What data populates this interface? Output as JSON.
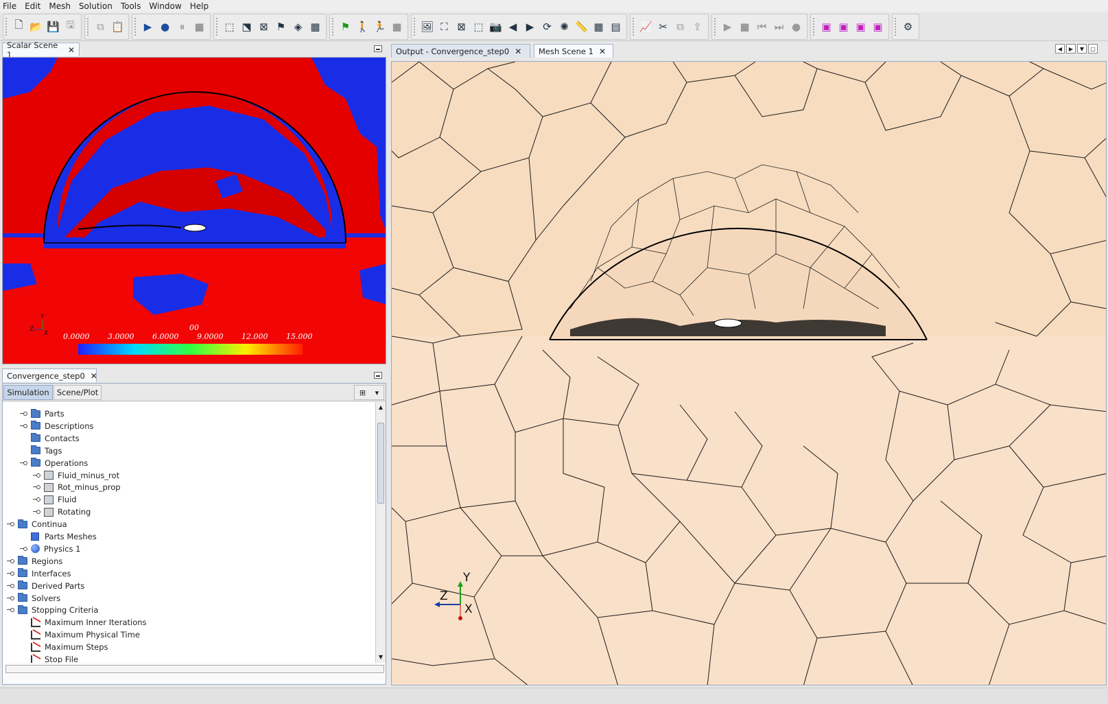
{
  "menu": [
    "File",
    "Edit",
    "Mesh",
    "Solution",
    "Tools",
    "Window",
    "Help"
  ],
  "toolbar": {
    "groups": [
      [
        "new-file-icon",
        "open-file-icon",
        "save-icon",
        "save-as-icon"
      ],
      [
        "copy-icon",
        "paste-icon"
      ],
      [
        "run-icon",
        "step-icon",
        "pause-icon",
        "stop-icon"
      ],
      [
        "mesh-select-icon",
        "mesh-surface-icon",
        "clear-mesh-icon",
        "flag-mesh-icon",
        "prism-mesh-icon",
        "volume-mesh-icon"
      ],
      [
        "initialize-flag-icon",
        "walk-icon",
        "run-fast-icon",
        "stop-red-icon"
      ],
      [
        "scene-icon",
        "fit-icon",
        "zoom-icon",
        "select-icon",
        "camera-icon",
        "back-icon",
        "forward-icon",
        "rotate-icon",
        "light-icon",
        "ruler-icon",
        "grid-icon",
        "grid2-icon"
      ],
      [
        "plot-icon",
        "cut-icon",
        "copy-plot-icon",
        "export-icon"
      ],
      [
        "play-icon",
        "stop-icon-2",
        "prev-frame-icon",
        "next-frame-icon",
        "record-icon"
      ],
      [
        "window-icon-1",
        "window-icon-2",
        "window-icon-3",
        "window-icon-4"
      ],
      [
        "settings-gear-icon"
      ]
    ]
  },
  "scalar_scene": {
    "tab_label": "Scalar Scene 1",
    "axis": {
      "y": "Y",
      "z": "Z",
      "x": "X"
    },
    "colorbar": {
      "title": "00",
      "ticks": [
        "0.0000",
        "3.0000",
        "6.0000",
        "9.0000",
        "12.000",
        "15.000"
      ]
    }
  },
  "tree_panel": {
    "tab_label": "Convergence_step0",
    "sub_tabs": [
      "Simulation",
      "Scene/Plot"
    ],
    "items": [
      {
        "label": "Parts",
        "icon": "folder",
        "level": 1
      },
      {
        "label": "Descriptions",
        "icon": "folder",
        "level": 1
      },
      {
        "label": "Contacts",
        "icon": "folder",
        "level": 1
      },
      {
        "label": "Tags",
        "icon": "folder",
        "level": 1
      },
      {
        "label": "Operations",
        "icon": "folder",
        "level": 1
      },
      {
        "label": "Fluid_minus_rot",
        "icon": "cube",
        "level": 2
      },
      {
        "label": "Rot_minus_prop",
        "icon": "cube",
        "level": 2
      },
      {
        "label": "Fluid",
        "icon": "cube",
        "level": 2
      },
      {
        "label": "Rotating",
        "icon": "cube",
        "level": 2
      },
      {
        "label": "Continua",
        "icon": "folder",
        "level": 0
      },
      {
        "label": "Parts Meshes",
        "icon": "grid",
        "level": 1
      },
      {
        "label": "Physics 1",
        "icon": "sphere",
        "level": 1
      },
      {
        "label": "Regions",
        "icon": "folder",
        "level": 0
      },
      {
        "label": "Interfaces",
        "icon": "folder",
        "level": 0
      },
      {
        "label": "Derived Parts",
        "icon": "folder",
        "level": 0
      },
      {
        "label": "Solvers",
        "icon": "folder",
        "level": 0
      },
      {
        "label": "Stopping Criteria",
        "icon": "folder",
        "level": 0
      },
      {
        "label": "Maximum Inner Iterations",
        "icon": "criteria",
        "level": 1
      },
      {
        "label": "Maximum Physical Time",
        "icon": "criteria",
        "level": 1
      },
      {
        "label": "Maximum Steps",
        "icon": "criteria",
        "level": 1
      },
      {
        "label": "Stop File",
        "icon": "criteria",
        "level": 1
      }
    ]
  },
  "right_tabs": [
    {
      "label": "Output - Convergence_step0",
      "active": false
    },
    {
      "label": "Mesh Scene 1",
      "active": true
    }
  ],
  "mesh_scene": {
    "axis": {
      "y": "Y",
      "z": "Z",
      "x": "X"
    }
  }
}
